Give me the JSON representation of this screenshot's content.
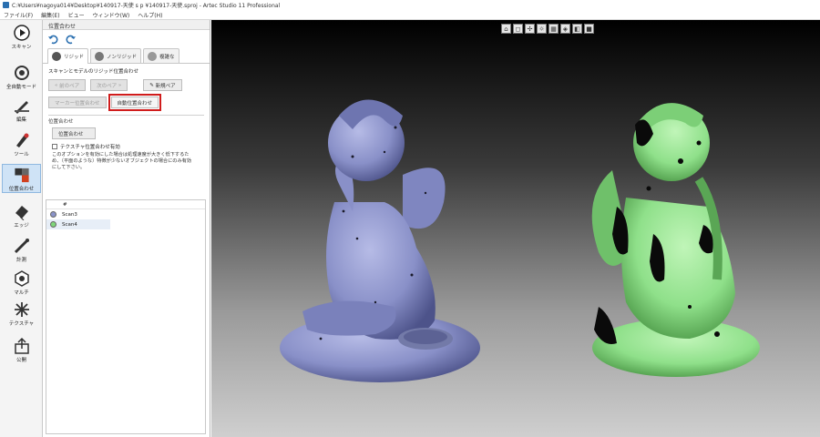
{
  "window": {
    "title": "C:¥Users¥nagoya014¥Desktop¥140917-天使 s p ¥140917-天使.sproj - Artec Studio 11 Professional"
  },
  "menu": [
    "ファイル(F)",
    "編集(E)",
    "ビュー",
    "ウィンドウ(W)",
    "ヘルプ(H)"
  ],
  "toolbar": {
    "items": [
      {
        "label": "スキャン",
        "icon": "play-icon"
      },
      {
        "label": "全自動モード",
        "icon": "auto-mode-icon"
      },
      {
        "label": "編集",
        "icon": "edit-icon"
      },
      {
        "label": "ツール",
        "icon": "tools-icon"
      },
      {
        "label": "位置合わせ",
        "icon": "align-icon"
      },
      {
        "label": "エッジ",
        "icon": "eraser-icon"
      },
      {
        "label": "計測",
        "icon": "measure-icon"
      },
      {
        "label": "マルチ",
        "icon": "multi-icon"
      },
      {
        "label": "テクスチャ",
        "icon": "texture-icon"
      },
      {
        "label": "公開",
        "icon": "publish-icon"
      }
    ],
    "active_index": 4
  },
  "panel": {
    "title": "位置合わせ",
    "tabs": [
      {
        "label": "リジッド"
      },
      {
        "label": "ノンリジッド"
      },
      {
        "label": "複雑な"
      }
    ],
    "section_title": "スキャンとモデルのリジッド位置合わせ",
    "prev_pair": "前のペア",
    "next_pair": "次のペア",
    "new_pair": "新規ペア",
    "marker_align": "マーカー位置合わせ",
    "auto_align": "自動位置合わせ",
    "group_title": "位置合わせ",
    "align_button": "位置合わせ",
    "texture_check": "テクスチャ位置合わせ有効",
    "note": "このオプションを有効にした場合は処理速度が大きく低下するため、（平面のような）特徴が少ないオブジェクトの場合にのみ有効にして下さい。",
    "list_header": "#",
    "scans": [
      {
        "name": "Scan3",
        "color": "#8a93c9"
      },
      {
        "name": "Scan4",
        "color": "#7ed67a"
      }
    ]
  },
  "viewport": {
    "buttons": [
      "home-view-icon",
      "cube-icon",
      "axes-icon",
      "light-icon",
      "wire-icon",
      "shaded-icon",
      "texture-view-icon",
      "solid-icon"
    ],
    "colors": {
      "scan3": "#8990c8",
      "scan4": "#8fe08a"
    }
  }
}
